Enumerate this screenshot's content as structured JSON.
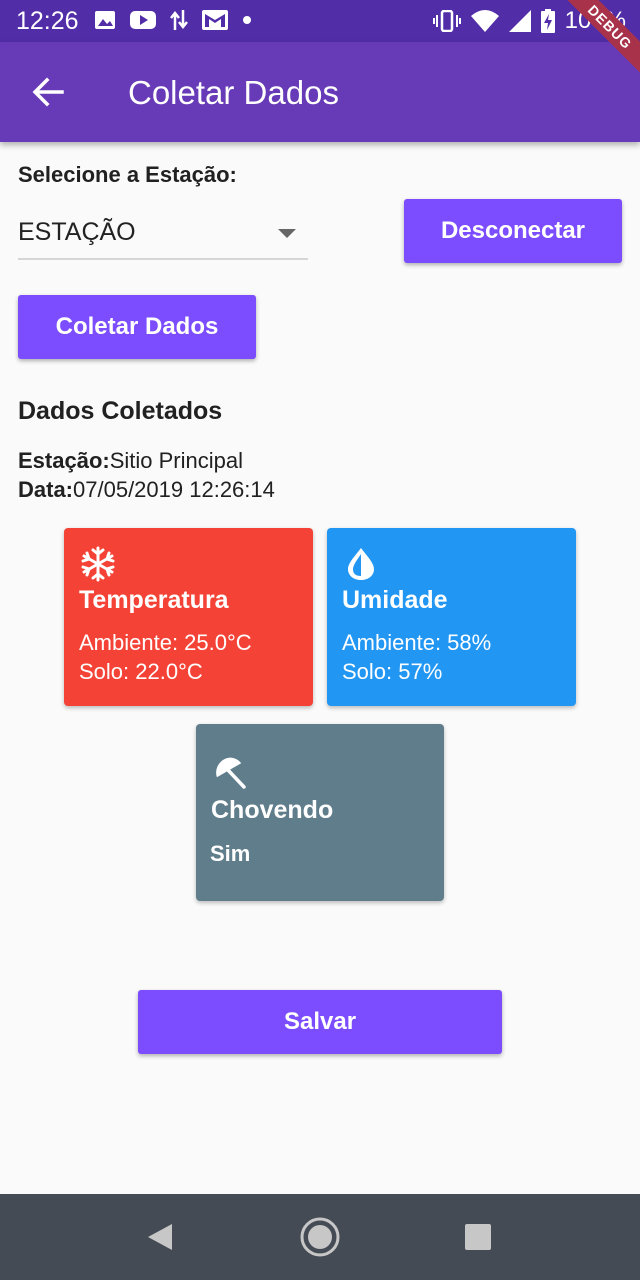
{
  "status_bar": {
    "time": "12:26",
    "battery": "100%",
    "icons": [
      "image-icon",
      "youtube-icon",
      "data-transfer-icon",
      "gmail-icon",
      "dot-icon",
      "vibrate-icon",
      "wifi-icon",
      "signal-icon",
      "battery-charging-icon"
    ]
  },
  "debug_banner": "DEBUG",
  "app_bar": {
    "title": "Coletar Dados",
    "back_icon": "arrow-back-icon",
    "color": "#673ab7"
  },
  "station_selector": {
    "label": "Selecione a Estação:",
    "selected_value": "ESTAÇÃO"
  },
  "buttons": {
    "disconnect": "Desconectar",
    "collect": "Coletar Dados",
    "save": "Salvar",
    "color": "#7c4dff"
  },
  "collected": {
    "title": "Dados Coletados",
    "station_label": "Estação:",
    "station_value": "Sitio Principal",
    "date_label": "Data:",
    "date_value": "07/05/2019 12:26:14"
  },
  "cards": {
    "temperature": {
      "icon": "snowflake-icon",
      "title": "Temperatura",
      "line1": "Ambiente: 25.0°C",
      "line2": "Solo: 22.0°C",
      "color": "#f44336"
    },
    "humidity": {
      "icon": "water-drop-icon",
      "title": "Umidade",
      "line1": "Ambiente: 58%",
      "line2": "Solo: 57%",
      "color": "#2196f3"
    },
    "rain": {
      "icon": "umbrella-icon",
      "title": "Chovendo",
      "value": "Sim",
      "color": "#607d8b"
    }
  },
  "nav_bar": {
    "icons": [
      "nav-back-icon",
      "nav-home-icon",
      "nav-recent-icon"
    ]
  }
}
